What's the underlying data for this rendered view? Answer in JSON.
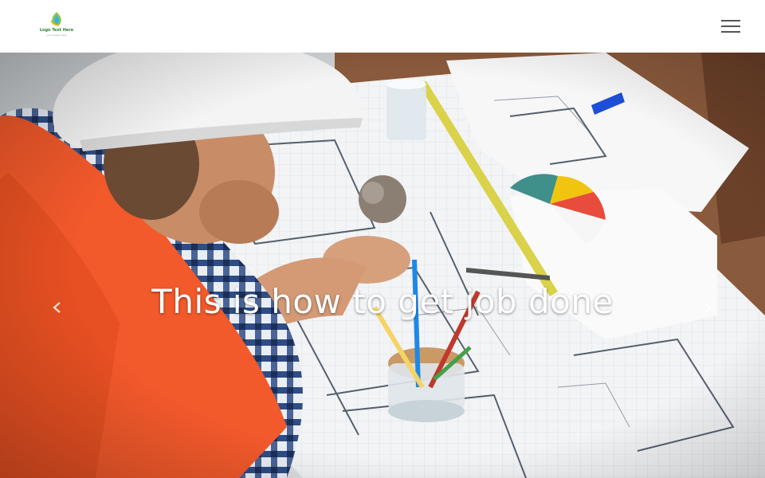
{
  "navbar": {
    "brand": {
      "name": "Logo Text Here",
      "tagline": "your slogan here"
    },
    "toggler_icon": "hamburger-menu-icon"
  },
  "carousel": {
    "caption": "This is how to get job done",
    "prev": {
      "label": "Previous",
      "icon": "chevron-left-icon"
    },
    "next": {
      "label": "Next",
      "icon": "chevron-right-icon"
    }
  },
  "colors": {
    "navbar_bg": "#ffffff",
    "caption": "#ffffff",
    "hamburger": "#555555",
    "logo_green": "#8bc34a",
    "logo_blue": "#29b6f6",
    "vest_orange": "#f2592b"
  }
}
